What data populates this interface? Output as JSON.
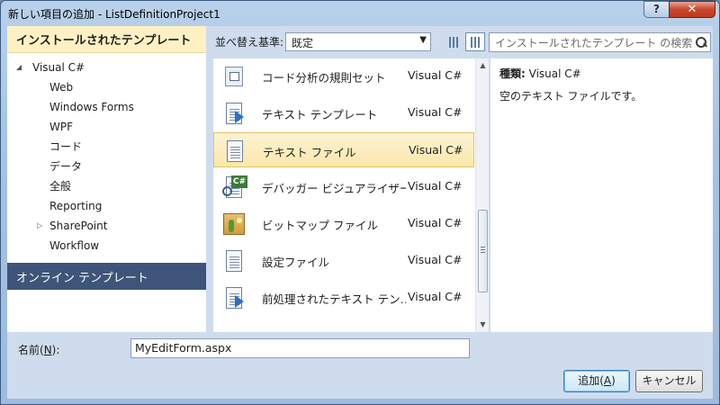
{
  "window": {
    "title": "新しい項目の追加 - ListDefinitionProject1",
    "help_label": "?",
    "close_label": "✕"
  },
  "left_panel": {
    "header": "インストールされたテンプレート",
    "tree": [
      {
        "label": "Visual C#",
        "level": 0,
        "expanded": true
      },
      {
        "label": "Web",
        "level": 1
      },
      {
        "label": "Windows Forms",
        "level": 1
      },
      {
        "label": "WPF",
        "level": 1
      },
      {
        "label": "コード",
        "level": 1
      },
      {
        "label": "データ",
        "level": 1
      },
      {
        "label": "全般",
        "level": 1,
        "selected": true
      },
      {
        "label": "Reporting",
        "level": 1
      },
      {
        "label": "SharePoint",
        "level": 1,
        "collapsed": true
      },
      {
        "label": "Workflow",
        "level": 1
      }
    ],
    "online_header": "オンライン テンプレート"
  },
  "toolbar": {
    "sort_label": "並べ替え基準:",
    "sort_value": "既定",
    "search_placeholder": "インストールされたテンプレート の検索"
  },
  "templates": [
    {
      "name": "コード分析の規則セット",
      "lang": "Visual C#",
      "icon": "ruleset-icon"
    },
    {
      "name": "テキスト テンプレート",
      "lang": "Visual C#",
      "icon": "text-template-icon"
    },
    {
      "name": "テキスト ファイル",
      "lang": "Visual C#",
      "icon": "text-file-icon",
      "selected": true
    },
    {
      "name": "デバッガー ビジュアライザー",
      "lang": "Visual C#",
      "icon": "debugger-visualizer-icon"
    },
    {
      "name": "ビットマップ ファイル",
      "lang": "Visual C#",
      "icon": "bitmap-icon"
    },
    {
      "name": "設定ファイル",
      "lang": "Visual C#",
      "icon": "settings-file-icon"
    },
    {
      "name": "前処理されたテキスト テン…",
      "lang": "Visual C#",
      "icon": "preprocessed-template-icon"
    }
  ],
  "details": {
    "type_label": "種類:",
    "type_value": "Visual C#",
    "description": "空のテキスト ファイルです。"
  },
  "name_field": {
    "label_prefix": "名前(",
    "label_key": "N",
    "label_suffix": "):",
    "value": "MyEditForm.aspx"
  },
  "buttons": {
    "ok_prefix": "追加(",
    "ok_key": "A",
    "ok_suffix": ")",
    "cancel": "キャンセル"
  },
  "colors": {
    "selection_bg": "#fbe7ab",
    "header_bg": "#fff1c4",
    "online_bg": "#3e5579"
  }
}
